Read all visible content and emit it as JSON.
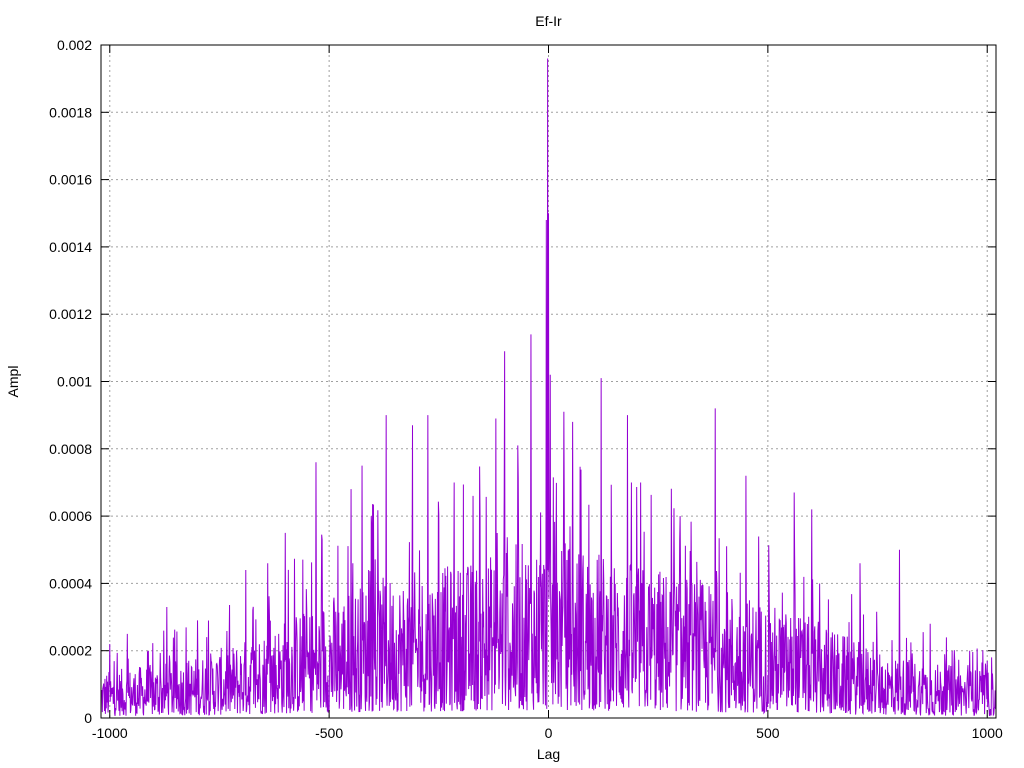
{
  "chart_data": {
    "type": "line",
    "title": "Ef-Ir",
    "xlabel": "Lag",
    "ylabel": "Ampl",
    "xlim": [
      -1020,
      1020
    ],
    "ylim": [
      0,
      0.002
    ],
    "grid": true,
    "x_ticks": [
      {
        "value": -1000,
        "label": "-1000"
      },
      {
        "value": -500,
        "label": "-500"
      },
      {
        "value": 0,
        "label": "0"
      },
      {
        "value": 500,
        "label": "500"
      },
      {
        "value": 1000,
        "label": "1000"
      }
    ],
    "y_ticks": [
      {
        "value": 0,
        "label": "0"
      },
      {
        "value": 0.0002,
        "label": "0.0002"
      },
      {
        "value": 0.0004,
        "label": "0.0004"
      },
      {
        "value": 0.0006,
        "label": "0.0006"
      },
      {
        "value": 0.0008,
        "label": "0.0008"
      },
      {
        "value": 0.001,
        "label": "0.001"
      },
      {
        "value": 0.0012,
        "label": "0.0012"
      },
      {
        "value": 0.0014,
        "label": "0.0014"
      },
      {
        "value": 0.0016,
        "label": "0.0016"
      },
      {
        "value": 0.0018,
        "label": "0.0018"
      },
      {
        "value": 0.002,
        "label": "0.002"
      }
    ],
    "series": [
      {
        "color": "#9400d3",
        "note": "Dense oscillating cross-correlation trace over lags -1020..1020; envelope below, prominent peaks listed",
        "envelope": [
          [
            -1020,
            0.00012
          ],
          [
            -900,
            0.00014
          ],
          [
            -800,
            0.00016
          ],
          [
            -700,
            0.0002
          ],
          [
            -600,
            0.00026
          ],
          [
            -500,
            0.00032
          ],
          [
            -400,
            0.00036
          ],
          [
            -300,
            0.00038
          ],
          [
            -200,
            0.0004
          ],
          [
            -100,
            0.00044
          ],
          [
            0,
            0.00048
          ],
          [
            100,
            0.00044
          ],
          [
            200,
            0.0004
          ],
          [
            300,
            0.00038
          ],
          [
            400,
            0.00034
          ],
          [
            500,
            0.0003
          ],
          [
            600,
            0.00026
          ],
          [
            700,
            0.0002
          ],
          [
            800,
            0.00016
          ],
          [
            900,
            0.00014
          ],
          [
            1020,
            0.00012
          ]
        ],
        "peaks": [
          [
            -1000,
            0.00022
          ],
          [
            -960,
            0.00025
          ],
          [
            -870,
            0.00033
          ],
          [
            -800,
            0.00029
          ],
          [
            -690,
            0.00044
          ],
          [
            -640,
            0.00046
          ],
          [
            -600,
            0.00055
          ],
          [
            -530,
            0.00076
          ],
          [
            -450,
            0.00068
          ],
          [
            -425,
            0.00075
          ],
          [
            -370,
            0.0009
          ],
          [
            -310,
            0.00087
          ],
          [
            -275,
            0.0009
          ],
          [
            -215,
            0.0007
          ],
          [
            -120,
            0.00089
          ],
          [
            -100,
            0.00109
          ],
          [
            -70,
            0.00081
          ],
          [
            -40,
            0.00114
          ],
          [
            -5,
            0.00148
          ],
          [
            -2,
            0.00196
          ],
          [
            0,
            0.0015
          ],
          [
            4,
            0.00102
          ],
          [
            35,
            0.00091
          ],
          [
            55,
            0.00088
          ],
          [
            120,
            0.00101
          ],
          [
            180,
            0.0009
          ],
          [
            210,
            0.0007
          ],
          [
            300,
            0.0006
          ],
          [
            380,
            0.00092
          ],
          [
            450,
            0.00072
          ],
          [
            560,
            0.00067
          ],
          [
            600,
            0.00062
          ],
          [
            710,
            0.00046
          ],
          [
            800,
            0.0005
          ],
          [
            870,
            0.00028
          ],
          [
            960,
            0.0002
          ]
        ]
      }
    ]
  }
}
